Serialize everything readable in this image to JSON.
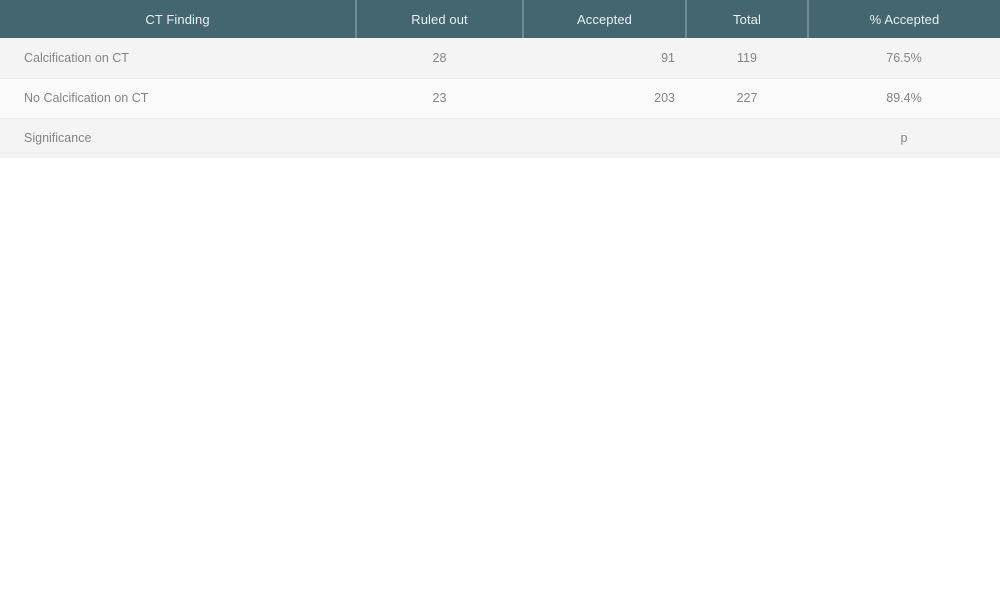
{
  "table": {
    "columns": [
      {
        "key": "finding",
        "label": "CT Finding"
      },
      {
        "key": "ruled_out",
        "label": "Ruled out"
      },
      {
        "key": "accepted",
        "label": "Accepted"
      },
      {
        "key": "total",
        "label": "Total"
      },
      {
        "key": "pct_accepted",
        "label": "% Accepted"
      }
    ],
    "rows": [
      {
        "finding": "Calcification on CT",
        "ruled_out": "28",
        "accepted": "91",
        "total": "119",
        "pct_accepted": "76.5%"
      },
      {
        "finding": "No Calcification on CT",
        "ruled_out": "23",
        "accepted": "203",
        "total": "227",
        "pct_accepted": "89.4%"
      },
      {
        "finding": "Significance",
        "ruled_out": "",
        "accepted": "",
        "total": "",
        "pct_accepted": "p"
      }
    ]
  },
  "colors": {
    "header_background": "#446670",
    "header_text": "#e9eff1",
    "header_divider": "#6e8c94",
    "row_odd_background": "#f4f4f4",
    "row_even_background": "#fafafa",
    "row_divider": "#ececec",
    "body_text": "#858585",
    "page_background": "#ffffff"
  }
}
